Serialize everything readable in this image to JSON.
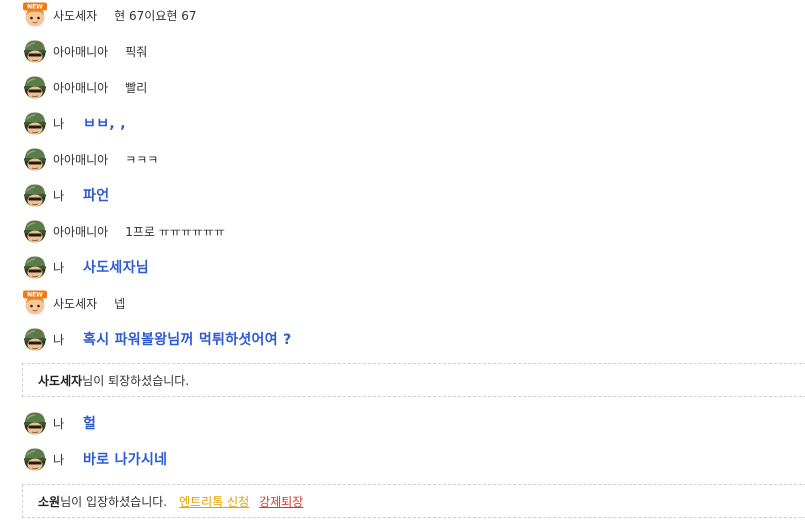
{
  "rows": [
    {
      "nick": "사도세자",
      "message": "현 67이요현 67",
      "self": false,
      "avatar": "new-badge-avatar-icon"
    },
    {
      "nick": "아아매니아",
      "message": "픽줘",
      "self": false,
      "avatar": "soldier-avatar-icon"
    },
    {
      "nick": "아아매니아",
      "message": "빨리",
      "self": false,
      "avatar": "soldier-avatar-icon"
    },
    {
      "nick": "나",
      "message": "ㅂㅂ, ,",
      "self": true,
      "avatar": "soldier-avatar-icon"
    },
    {
      "nick": "아아매니아",
      "message": "ㅋㅋㅋ",
      "self": false,
      "avatar": "soldier-avatar-icon"
    },
    {
      "nick": "나",
      "message": "파언",
      "self": true,
      "avatar": "soldier-avatar-icon"
    },
    {
      "nick": "아아매니아",
      "message": "1프로 ㅠㅠㅠㅠㅠㅠ",
      "self": false,
      "avatar": "soldier-avatar-icon"
    },
    {
      "nick": "나",
      "message": "사도세자님",
      "self": true,
      "avatar": "soldier-avatar-icon"
    },
    {
      "nick": "사도세자",
      "message": "넵",
      "self": false,
      "avatar": "new-badge-avatar-icon"
    },
    {
      "nick": "나",
      "message": "혹시 파워볼왕님꺼 먹튀하셧어여 ?",
      "self": true,
      "avatar": "soldier-avatar-icon"
    }
  ],
  "notice_leave": {
    "name": "사도세자",
    "text": "님이 퇴장하셨습니다."
  },
  "rows2": [
    {
      "nick": "나",
      "message": "헐",
      "self": true,
      "avatar": "soldier-avatar-icon"
    },
    {
      "nick": "나",
      "message": "바로 나가시네",
      "self": true,
      "avatar": "soldier-avatar-icon"
    }
  ],
  "notice_enter": {
    "name": "소원",
    "text": "님이 입장하셨습니다.",
    "link_entry": "엔트리톡 신청",
    "link_kick": "강제퇴장"
  },
  "badge_text": "NEW",
  "colors": {
    "self_message": "#2e5bd0",
    "link_entry": "#e6a100",
    "link_kick": "#d23c2c",
    "helmet": "#5d7a4a"
  }
}
